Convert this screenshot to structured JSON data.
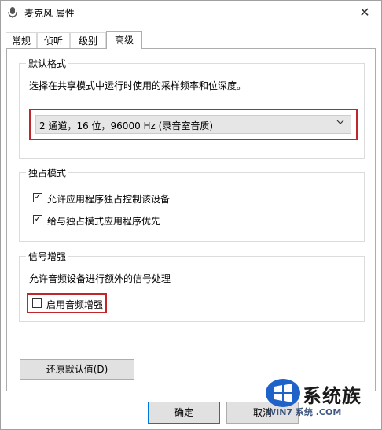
{
  "window": {
    "title": "麦克风 属性",
    "close_symbol": "✕"
  },
  "tabs": [
    {
      "label": "常规"
    },
    {
      "label": "侦听"
    },
    {
      "label": "级别"
    },
    {
      "label": "高级"
    }
  ],
  "default_format": {
    "title": "默认格式",
    "description": "选择在共享模式中运行时使用的采样频率和位深度。",
    "selected_value": "2 通道，16 位，96000 Hz (录音室音质)"
  },
  "exclusive_mode": {
    "title": "独占模式",
    "options": [
      {
        "label": "允许应用程序独占控制该设备",
        "checked": true
      },
      {
        "label": "给与独占模式应用程序优先",
        "checked": true
      }
    ]
  },
  "signal_enhancement": {
    "title": "信号增强",
    "description": "允许音频设备进行额外的信号处理",
    "option": {
      "label": "启用音频增强",
      "checked": false
    }
  },
  "restore_defaults_label": "还原默认值(D)",
  "footer": {
    "ok_label": "确定",
    "cancel_label": "取消"
  },
  "watermark": {
    "brand_text": "系统族",
    "url_text": "WIN7 系统 .COM"
  },
  "colors": {
    "highlight_red": "#c0272d",
    "accent_blue": "#0078d7"
  },
  "icons": {
    "title_icon": "microphone-icon",
    "dropdown": "chevron-down-icon"
  }
}
